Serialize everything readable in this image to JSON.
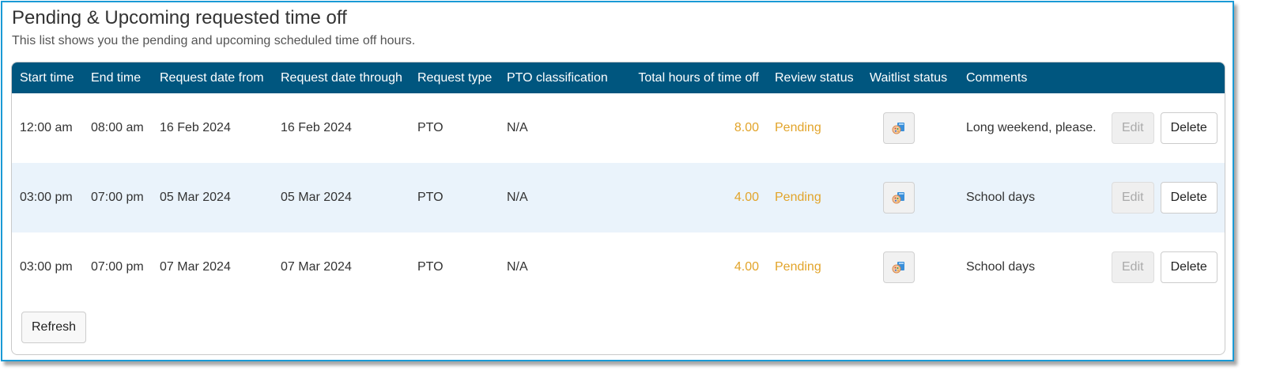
{
  "section": {
    "title": "Pending & Upcoming requested time off",
    "subtitle": "This list shows you the pending and upcoming scheduled time off hours."
  },
  "table": {
    "headers": [
      "Start time",
      "End time",
      "Request date from",
      "Request date through",
      "Request type",
      "PTO classification",
      "Total hours of time off",
      "Review status",
      "Waitlist status",
      "Comments"
    ],
    "rows": [
      {
        "start_time": "12:00 am",
        "end_time": "08:00 am",
        "date_from": "16 Feb 2024",
        "date_through": "16 Feb 2024",
        "request_type": "PTO",
        "pto_classification": "N/A",
        "total_hours": "8.00",
        "review_status": "Pending",
        "waitlist_icon": "waitlist-icon",
        "comments": "Long weekend, please.",
        "edit_label": "Edit",
        "delete_label": "Delete"
      },
      {
        "start_time": "03:00 pm",
        "end_time": "07:00 pm",
        "date_from": "05 Mar 2024",
        "date_through": "05 Mar 2024",
        "request_type": "PTO",
        "pto_classification": "N/A",
        "total_hours": "4.00",
        "review_status": "Pending",
        "waitlist_icon": "waitlist-icon",
        "comments": "School days",
        "edit_label": "Edit",
        "delete_label": "Delete"
      },
      {
        "start_time": "03:00 pm",
        "end_time": "07:00 pm",
        "date_from": "07 Mar 2024",
        "date_through": "07 Mar 2024",
        "request_type": "PTO",
        "pto_classification": "N/A",
        "total_hours": "4.00",
        "review_status": "Pending",
        "waitlist_icon": "waitlist-icon",
        "comments": "School days",
        "edit_label": "Edit",
        "delete_label": "Delete"
      }
    ]
  },
  "footer": {
    "refresh_label": "Refresh"
  },
  "colors": {
    "header_bg": "#00567f",
    "frame_border": "#1a9ad6",
    "pending": "#e2a42a",
    "alt_row": "#eaf3fb"
  }
}
